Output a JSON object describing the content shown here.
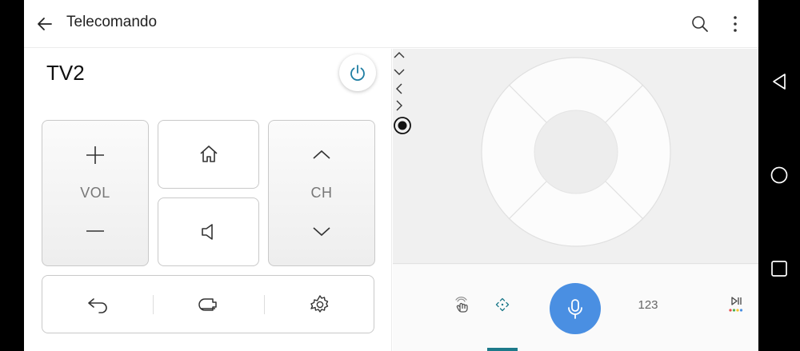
{
  "appbar": {
    "title": "Telecomando",
    "back_icon": "arrow-left-icon",
    "search_icon": "search-icon",
    "more_icon": "more-vertical-icon"
  },
  "device": {
    "name": "TV2",
    "power_icon": "power-icon"
  },
  "volume": {
    "label": "VOL",
    "up_icon": "plus-icon",
    "down_icon": "minus-icon"
  },
  "channel": {
    "label": "CH",
    "up_icon": "chevron-up-icon",
    "down_icon": "chevron-down-icon"
  },
  "tiles": {
    "home_icon": "home-icon",
    "mute_icon": "speaker-icon"
  },
  "bottom_controls": [
    {
      "name": "back",
      "icon": "return-arrow-icon"
    },
    {
      "name": "input",
      "icon": "input-source-icon"
    },
    {
      "name": "settings",
      "icon": "gear-icon"
    }
  ],
  "dpad": {
    "center_icon": "ok-icon",
    "up_icon": "chevron-up-icon",
    "down_icon": "chevron-down-icon",
    "left_icon": "chevron-left-icon",
    "right_icon": "chevron-right-icon"
  },
  "tabs": [
    {
      "name": "touchpad",
      "icon": "touch-icon"
    },
    {
      "name": "dpad",
      "icon": "direction-pad-icon",
      "selected": true
    },
    {
      "name": "voice",
      "icon": "microphone-icon"
    },
    {
      "name": "numbers",
      "label": "123"
    },
    {
      "name": "media",
      "icon": "play-pause-icon"
    }
  ],
  "colors": {
    "accent": "#4a8fe2",
    "indicator": "#1d7a8a",
    "power": "#1f7ea3"
  },
  "system_nav": [
    "back-triangle-icon",
    "home-circle-icon",
    "recents-square-icon"
  ]
}
